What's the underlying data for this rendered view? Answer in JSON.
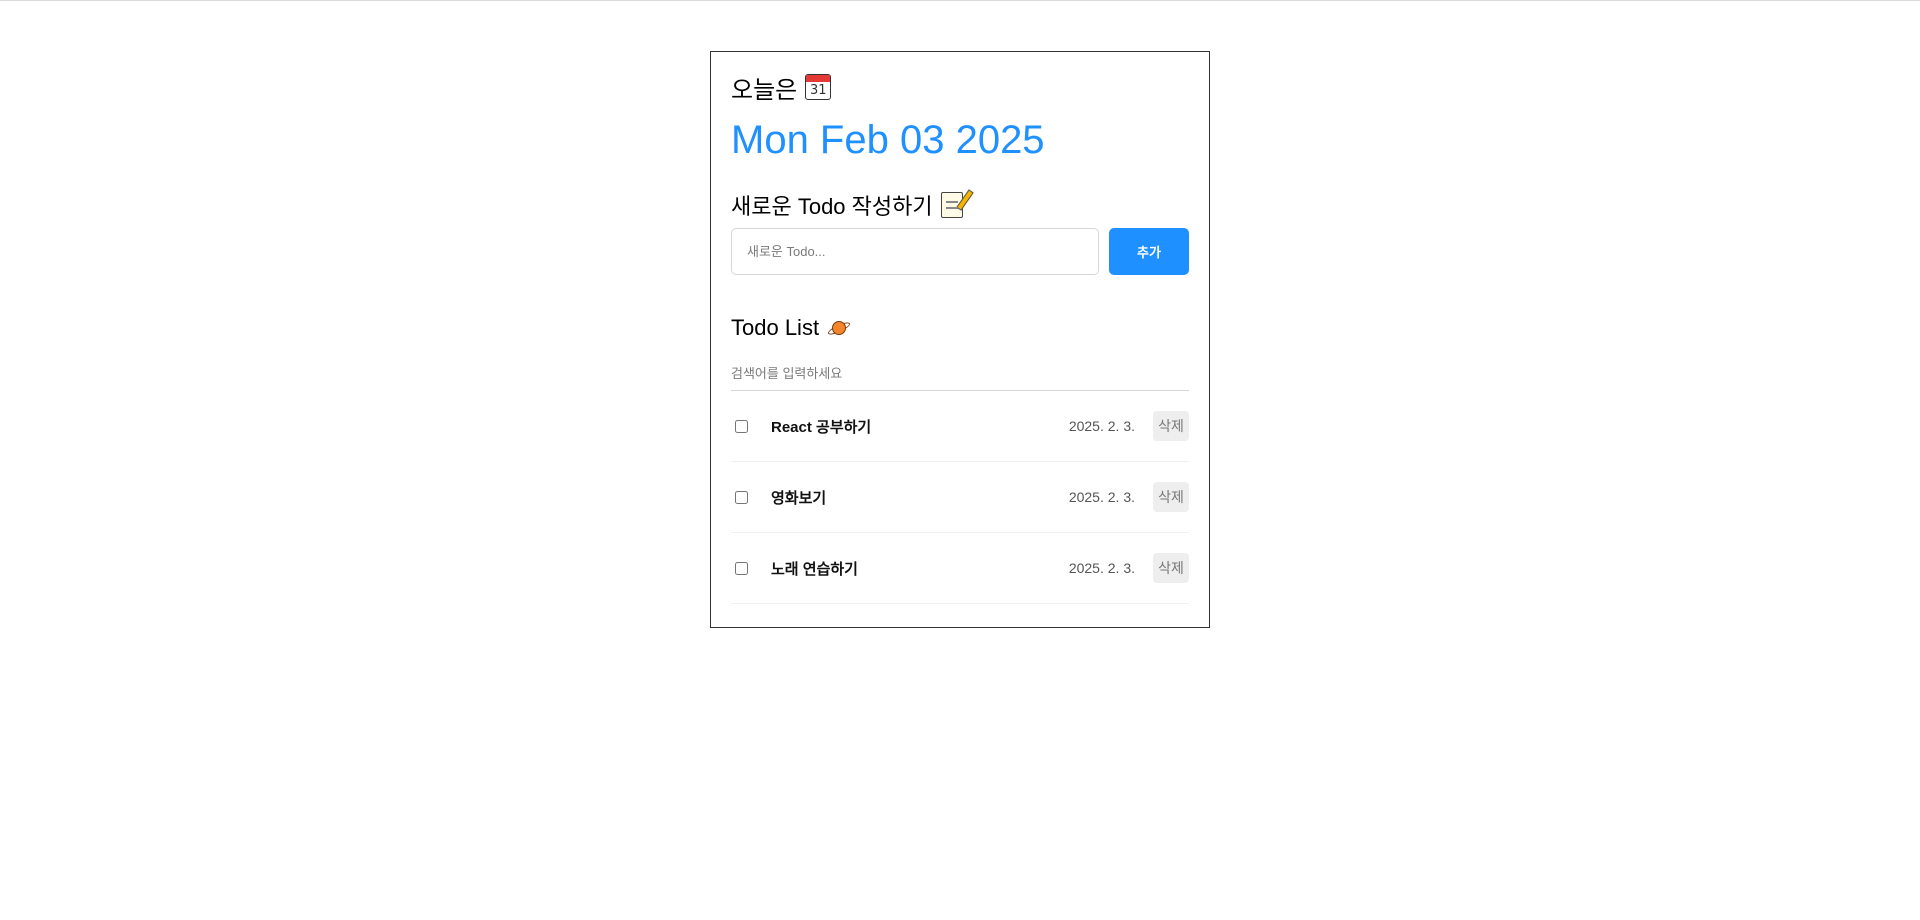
{
  "header": {
    "today_label": "오늘은",
    "calendar_icon": "calendar-icon",
    "calendar_day": "31",
    "date": "Mon Feb 03 2025"
  },
  "editor": {
    "title": "새로운 Todo 작성하기",
    "icon": "memo-icon",
    "input_value": "",
    "input_placeholder": "새로운 Todo...",
    "add_button_label": "추가"
  },
  "list": {
    "title": "Todo List",
    "icon": "planet-icon",
    "search_value": "",
    "search_placeholder": "검색어를 입력하세요",
    "items": [
      {
        "content": "React 공부하기",
        "date": "2025. 2. 3.",
        "checked": false,
        "delete_label": "삭제"
      },
      {
        "content": "영화보기",
        "date": "2025. 2. 3.",
        "checked": false,
        "delete_label": "삭제"
      },
      {
        "content": "노래 연습하기",
        "date": "2025. 2. 3.",
        "checked": false,
        "delete_label": "삭제"
      }
    ]
  },
  "colors": {
    "accent": "#1e90ff",
    "border": "#333333",
    "delete_bg": "#eeeeee"
  }
}
